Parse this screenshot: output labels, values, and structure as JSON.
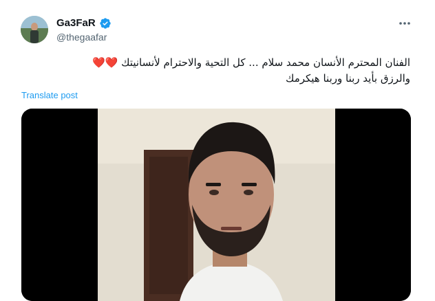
{
  "author": {
    "display_name": "Ga3FaR",
    "handle": "@thegaafar",
    "verified": true,
    "verified_icon_color": "#1d9bf0"
  },
  "tweet": {
    "text_line_1": "الفنان المحترم الأنسان محمد سلام ... كل التحية والاحترام لأنسانيتك",
    "text_line_2": "والرزق بأيد ربنا وربنا هيكرمك",
    "hearts": "❤️❤️"
  },
  "actions": {
    "translate_label": "Translate post",
    "more_icon": "more-horizontal-icon"
  },
  "colors": {
    "accent": "#1d9bf0",
    "text": "#0f1419",
    "secondary_text": "#536471",
    "heart": "#e0245e"
  }
}
